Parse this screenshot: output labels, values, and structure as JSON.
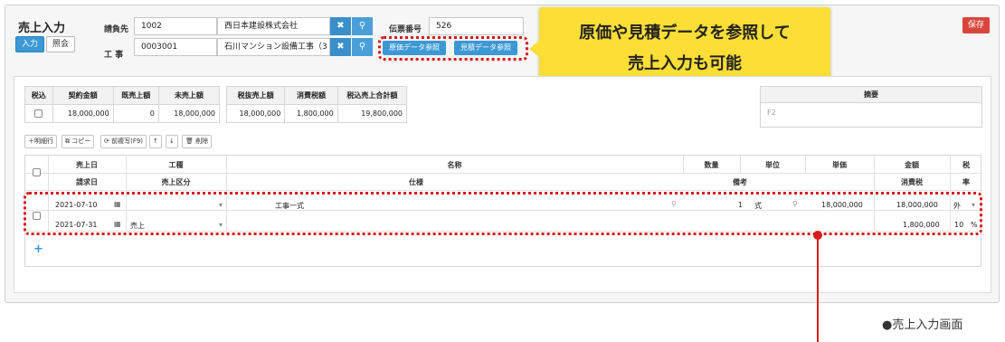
{
  "header": {
    "title": "売上入力",
    "mode_input": "入力",
    "mode_view": "照会",
    "client_label": "請負先",
    "client_code": "1002",
    "client_name": "西日本建設株式会社",
    "project_label": "工 事",
    "project_code": "0003001",
    "project_name": "石川マンション設備工事（3",
    "slip_label": "伝票番号",
    "slip_number": "526",
    "cost_ref_button": "原価データ参照",
    "estimate_ref_button": "見積データ参照",
    "save_button": "保存"
  },
  "callout": {
    "line1": "原価や見積データを参照して",
    "line2": "売上入力も可能"
  },
  "summary1": {
    "headers": [
      "税込",
      "契約金額",
      "既売上額",
      "未売上額"
    ],
    "contract_amount": "18,000,000",
    "sold_amount": "0",
    "unsold_amount": "18,000,000"
  },
  "summary2": {
    "headers": [
      "税抜売上額",
      "消費税額",
      "税込売上合計額"
    ],
    "values": [
      "18,000,000",
      "1,800,000",
      "19,800,000"
    ]
  },
  "memo": {
    "header": "摘要",
    "value": "F2"
  },
  "toolbar": {
    "add_row": "＋明細行",
    "copy": "⧉ コピー",
    "prev_copy": "⟳ 前複写(F9)",
    "up": "↑",
    "down": "↓",
    "delete": "🗑 削除"
  },
  "grid": {
    "headers_top": [
      "売上日",
      "工種",
      "名称",
      "数量",
      "単位",
      "単価",
      "金額",
      "税"
    ],
    "headers_bottom": [
      "請求日",
      "売上区分",
      "仕様",
      "備考",
      "消費税",
      "率"
    ],
    "row1": {
      "date": "2021-07-10",
      "name": "工事一式",
      "qty": "1",
      "unit": "式",
      "unit_price": "18,000,000",
      "amount": "18,000,000",
      "tax": "外"
    },
    "row2": {
      "date": "2021-07-31",
      "category": "売上",
      "tax_amount": "1,800,000",
      "rate": "10",
      "pct": "%"
    },
    "add": "+"
  },
  "caption": "●売上入力画面",
  "colors": {
    "accent_blue": "#3b98d4",
    "save_red": "#d9453b",
    "callout_yellow": "#fdde36",
    "highlight_red": "#d81b1b"
  }
}
